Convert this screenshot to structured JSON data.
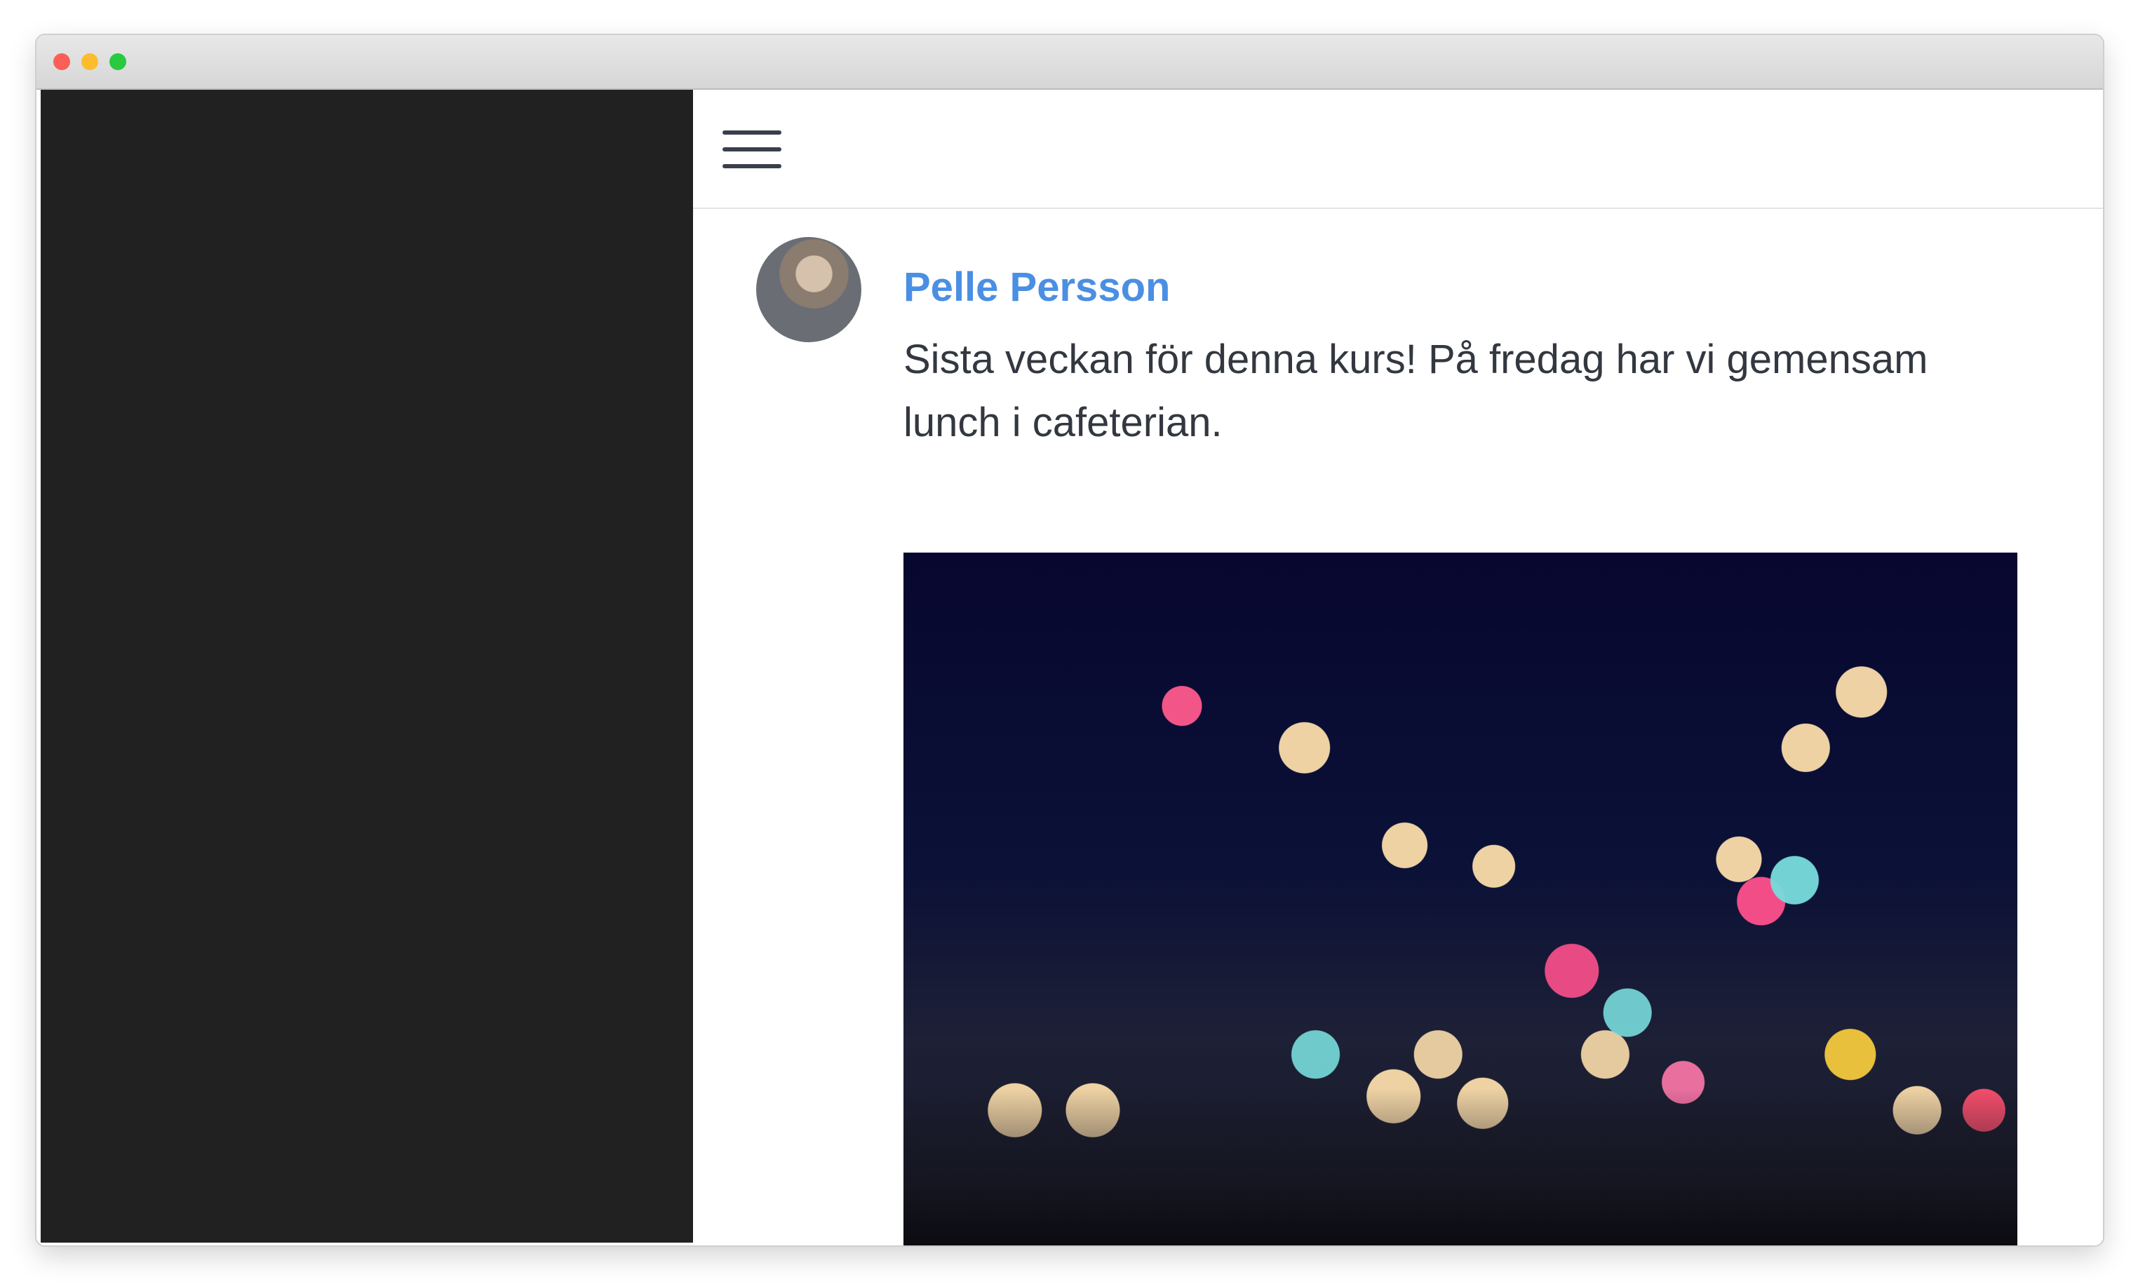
{
  "post": {
    "author": "Pelle Persson",
    "text": "Sista veckan för denna kurs! På fredag har vi gemensam lunch i cafeterian."
  },
  "icons": {
    "menu": "hamburger-menu-icon",
    "avatar": "user-avatar",
    "photo": "post-image"
  },
  "colors": {
    "sidebar_bg": "#212121",
    "author_link": "#4a8fe3",
    "text": "#333840"
  }
}
